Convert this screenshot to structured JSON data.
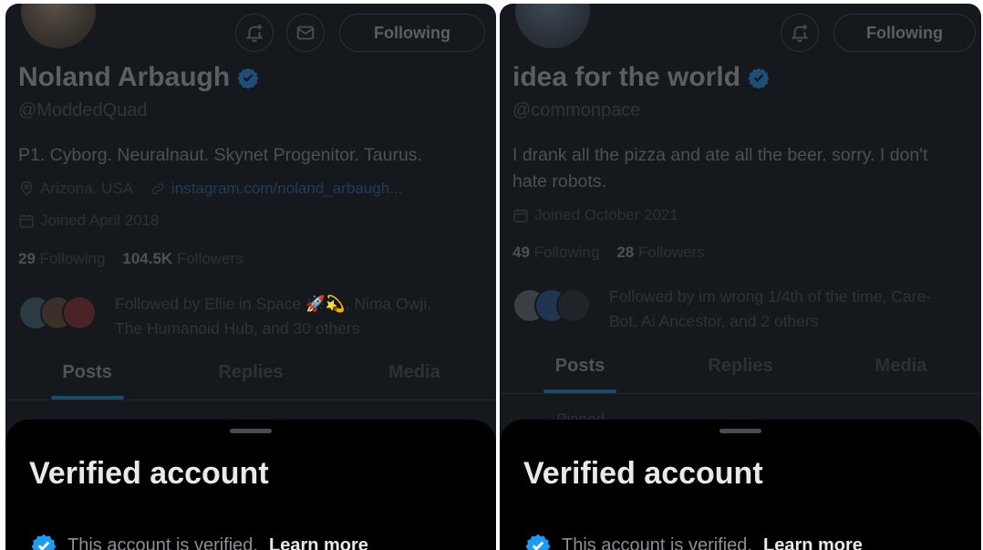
{
  "left": {
    "follow_label": "Following",
    "name": "Noland Arbaugh",
    "handle": "@ModdedQuad",
    "bio": "P1. Cyborg. Neuralnaut. Skynet Progenitor. Taurus.",
    "location": "Arizona, USA",
    "link": "instagram.com/noland_arbaugh...",
    "joined": "Joined April 2018",
    "following_count": "29",
    "following_label": "Following",
    "followers_count": "104.5K",
    "followers_label": "Followers",
    "followed_by_line1": "Followed by Ellie in Space 🚀💫, Nima Owji,",
    "followed_by_line2": "The Humanoid Hub, and 30 others",
    "tabs": [
      "Posts",
      "Replies",
      "Media"
    ],
    "sheet_title": "Verified account",
    "sheet_text": "This account is verified.",
    "sheet_link": "Learn more"
  },
  "right": {
    "follow_label": "Following",
    "name": "idea for the world",
    "handle": "@commonpace",
    "bio_line1": "I drank all the pizza and ate all the beer. sorry. I don't",
    "bio_line2": "hate robots.",
    "joined": "Joined October 2021",
    "following_count": "49",
    "following_label": "Following",
    "followers_count": "28",
    "followers_label": "Followers",
    "followed_by_line1": "Followed by im wrong 1/4th of the time, Care-",
    "followed_by_line2": "Bot, Ai Ancestor, and 2 others",
    "tabs": [
      "Posts",
      "Replies",
      "Media"
    ],
    "pinned": "Pinned",
    "sheet_title": "Verified account",
    "sheet_text": "This account is verified.",
    "sheet_link": "Learn more"
  },
  "colors": {
    "verified_blue": "#1d9bf0",
    "sheet_bg": "#000000",
    "panel_bg": "#15181c"
  }
}
